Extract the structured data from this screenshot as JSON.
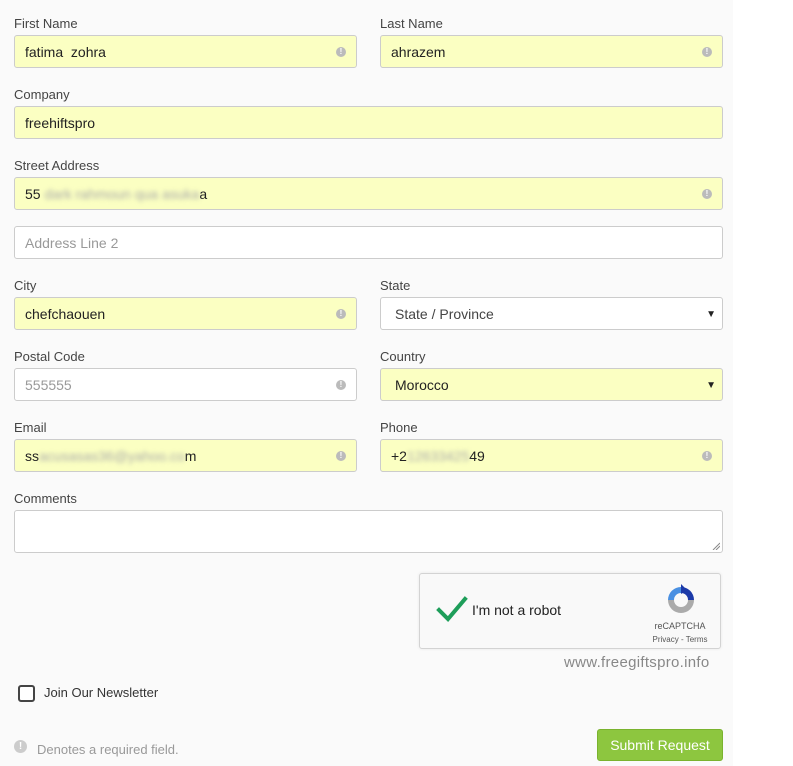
{
  "form": {
    "first_name": {
      "label": "First Name",
      "value": "fatima  zohra"
    },
    "last_name": {
      "label": "Last Name",
      "value": "ahrazem"
    },
    "company": {
      "label": "Company",
      "value": "freehiftspro"
    },
    "street": {
      "label": "Street Address",
      "value_start": "55",
      "value_blurred": "dark rahmoun qua asuka",
      "value_end": "a"
    },
    "address2": {
      "placeholder": "Address Line 2"
    },
    "city": {
      "label": "City",
      "value": "chefchaouen"
    },
    "state": {
      "label": "State",
      "selected": "State / Province"
    },
    "postal": {
      "label": "Postal Code",
      "placeholder": "555555"
    },
    "country": {
      "label": "Country",
      "selected": "Morocco"
    },
    "email": {
      "label": "Email",
      "value_start": "ss",
      "value_blurred": "acusasas36@yahoo.co",
      "value_end": "m"
    },
    "phone": {
      "label": "Phone",
      "value_start": "+2",
      "value_blurred": "12633425",
      "value_end": "49"
    },
    "comments": {
      "label": "Comments"
    }
  },
  "recaptcha": {
    "text": "I'm not a robot",
    "brand": "reCAPTCHA",
    "terms": "Privacy - Terms"
  },
  "watermark": "www.freegiftspro.info",
  "newsletter_label": "Join Our Newsletter",
  "required_note": "Denotes a required field.",
  "submit_label": "Submit Request",
  "colors": {
    "filled_bg": "#fbffc2",
    "submit_bg": "#8dc63f",
    "check_green": "#1e9e5a"
  }
}
